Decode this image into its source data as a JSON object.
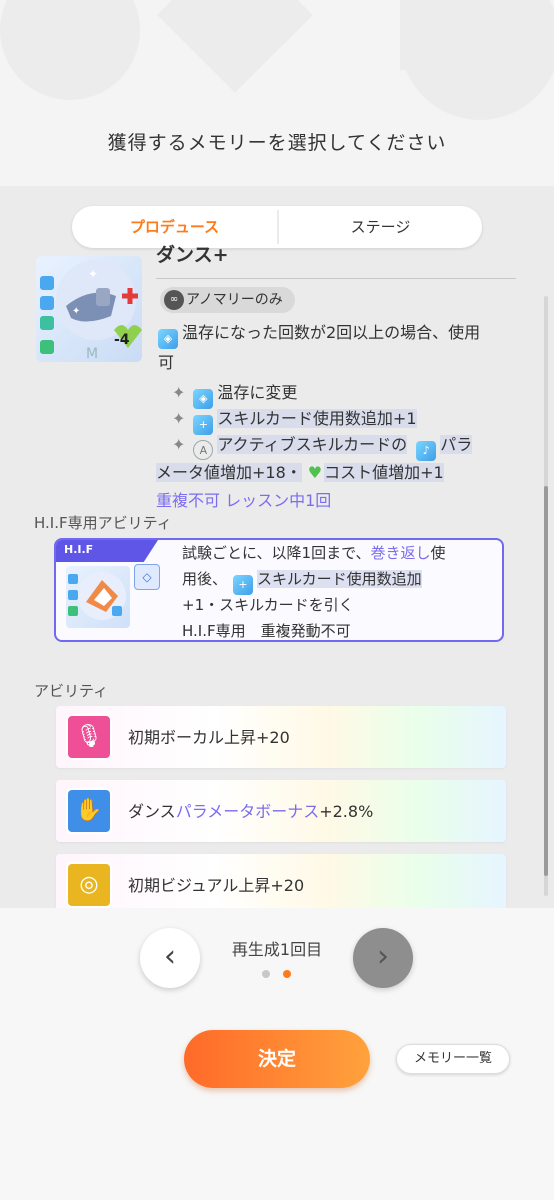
{
  "header": {
    "title": "獲得するメモリーを選択してください"
  },
  "tabs": [
    {
      "label": "プロデュース",
      "active": true
    },
    {
      "label": "ステージ",
      "active": false
    }
  ],
  "memory": {
    "name": "ダンス+",
    "card_cost_badge": "-4",
    "anomaly_badge": "アノマリーのみ",
    "condition_line1": "温存になった回数が2回以上の場合、使用",
    "condition_line2": "可",
    "effects": [
      "温存に変更",
      "スキルカード使用数追加+1",
      "アクティブスキルカードの",
      "パラ"
    ],
    "effect_line4_a": "メータ値増加+18・",
    "effect_line4_b": "コスト値増加+1",
    "limit": "重複不可 レッスン中1回"
  },
  "hif": {
    "section_label": "H.I.F専用アビリティ",
    "tag": "H.I.F",
    "line1_a": "試験ごとに、以降1回まで、",
    "line1_b": "巻き返し",
    "line1_c": "使",
    "line2_a": "用後、",
    "line2_b": "スキルカード使用数追加",
    "line3": "+1・スキルカードを引く",
    "line4": "H.I.F専用　重複発動不可"
  },
  "abilities": {
    "section_label": "アビリティ",
    "items": [
      {
        "text": "初期ボーカル上昇+20"
      },
      {
        "text_a": "ダンス",
        "text_b": "パラメータボーナス",
        "text_c": "+2.8%"
      },
      {
        "text": "初期ビジュアル上昇+20"
      }
    ]
  },
  "footer": {
    "prev_icon": "chevron-left-icon",
    "next_icon": "chevron-right-icon",
    "regen_label": "再生成1回目",
    "confirm_label": "決定",
    "memory_list_label": "メモリー一覧"
  },
  "colors": {
    "accent_orange": "#ff7a1a",
    "highlight_purple": "#7b6cf0",
    "hif_border": "#6f6af0"
  }
}
